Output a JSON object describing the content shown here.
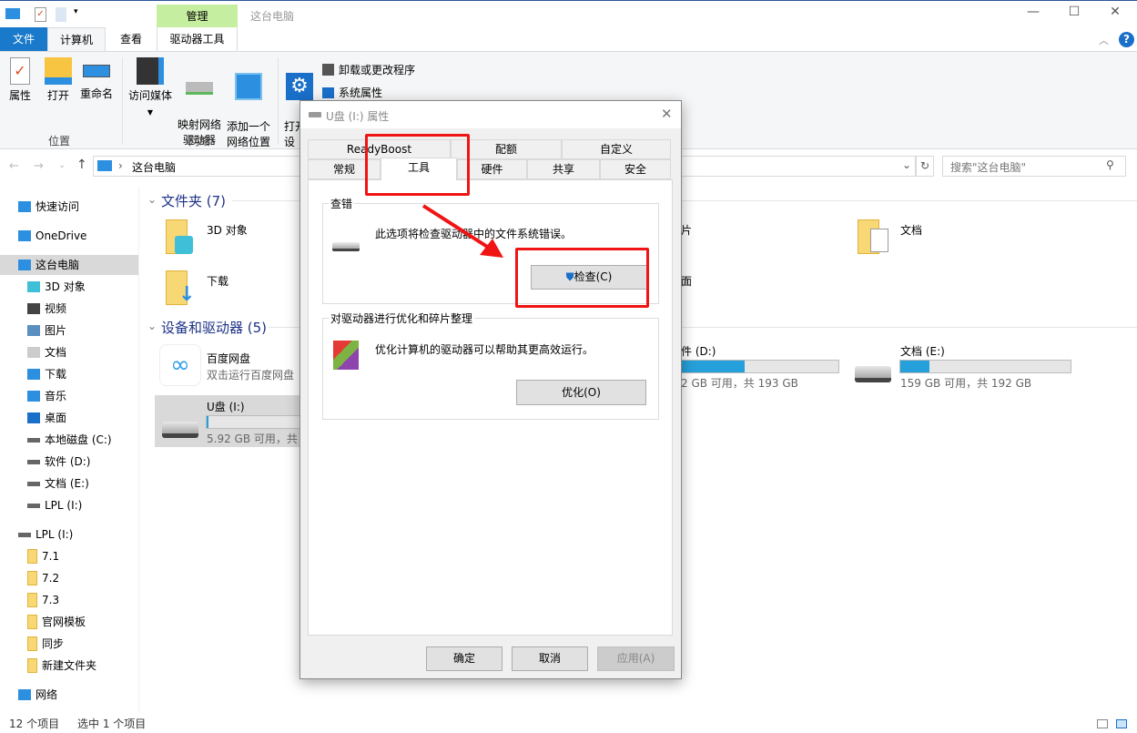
{
  "window": {
    "title": "这台电脑",
    "context_tab": "管理",
    "minimize": "—",
    "maximize": "☐",
    "close": "✕"
  },
  "ribbon": {
    "tabs": [
      {
        "label": "文件"
      },
      {
        "label": "计算机"
      },
      {
        "label": "查看"
      },
      {
        "label": "驱动器工具"
      }
    ],
    "groups": [
      {
        "label": "位置",
        "items": [
          "属性",
          "打开",
          "重命名"
        ]
      },
      {
        "label": "网络",
        "items": [
          "访问媒体",
          "映射网络\n驱动器",
          "添加一个\n网络位置"
        ]
      },
      {
        "label": "",
        "items": [
          "打开\n设"
        ]
      }
    ],
    "system_items": [
      "卸载或更改程序",
      "系统属性"
    ]
  },
  "address": {
    "path": "这台电脑",
    "search_placeholder": "搜索\"这台电脑\""
  },
  "nav": {
    "items": [
      {
        "label": "快速访问",
        "icon": "star-icon"
      },
      {
        "label": "OneDrive",
        "icon": "cloud-icon"
      },
      {
        "label": "这台电脑",
        "icon": "computer-icon",
        "selected": true
      },
      {
        "label": "3D 对象",
        "icon": "cube-icon"
      },
      {
        "label": "视频",
        "icon": "video-icon"
      },
      {
        "label": "图片",
        "icon": "picture-icon"
      },
      {
        "label": "文档",
        "icon": "document-icon"
      },
      {
        "label": "下载",
        "icon": "download-icon"
      },
      {
        "label": "音乐",
        "icon": "music-icon"
      },
      {
        "label": "桌面",
        "icon": "desktop-icon"
      },
      {
        "label": "本地磁盘 (C:)",
        "icon": "drive-icon"
      },
      {
        "label": "软件 (D:)",
        "icon": "drive-icon"
      },
      {
        "label": "文档 (E:)",
        "icon": "drive-icon"
      },
      {
        "label": "LPL (I:)",
        "icon": "drive-icon"
      },
      {
        "label": "LPL (I:)",
        "icon": "drive-icon"
      },
      {
        "label": "7.1",
        "icon": "folder-icon"
      },
      {
        "label": "7.2",
        "icon": "folder-icon"
      },
      {
        "label": "7.3",
        "icon": "folder-icon"
      },
      {
        "label": "官网模板",
        "icon": "folder-icon"
      },
      {
        "label": "同步",
        "icon": "folder-icon"
      },
      {
        "label": "新建文件夹",
        "icon": "folder-icon"
      },
      {
        "label": "网络",
        "icon": "network-icon"
      }
    ]
  },
  "content": {
    "folders_header": "文件夹 (7)",
    "folders": [
      {
        "label": "3D 对象"
      },
      {
        "label": "下载"
      },
      {
        "label": "片"
      },
      {
        "label": "面"
      },
      {
        "label": "文档"
      }
    ],
    "devices_header": "设备和驱动器 (5)",
    "baidu": {
      "name": "百度网盘",
      "desc": "双击运行百度网盘"
    },
    "drives": [
      {
        "name": "U盘 (I:)",
        "info": "5.92 GB 可用，共",
        "used_fraction": 0.02
      },
      {
        "name": "件 (D:)",
        "info": "2 GB 可用，共 193 GB",
        "used_fraction": 0.4
      },
      {
        "name": "文档 (E:)",
        "info": "159 GB 可用，共 192 GB",
        "used_fraction": 0.17
      }
    ]
  },
  "dialog": {
    "title": "U盘 (I:) 属性",
    "tabs_row1": [
      "ReadyBoost",
      "配额",
      "自定义"
    ],
    "tabs_row2": [
      "常规",
      "工具",
      "硬件",
      "共享",
      "安全"
    ],
    "active_tab": "工具",
    "check_group": {
      "title": "查错",
      "desc": "此选项将检查驱动器中的文件系统错误。",
      "button": "检查(C)"
    },
    "optimize_group": {
      "title": "对驱动器进行优化和碎片整理",
      "desc": "优化计算机的驱动器可以帮助其更高效运行。",
      "button": "优化(O)"
    },
    "buttons": {
      "ok": "确定",
      "cancel": "取消",
      "apply": "应用(A)"
    }
  },
  "status": {
    "count": "12 个项目",
    "selected": "选中 1 个项目"
  },
  "colors": {
    "accent": "#1979ca",
    "annotation": "#f01414",
    "context_tab": "#c6eea0"
  }
}
